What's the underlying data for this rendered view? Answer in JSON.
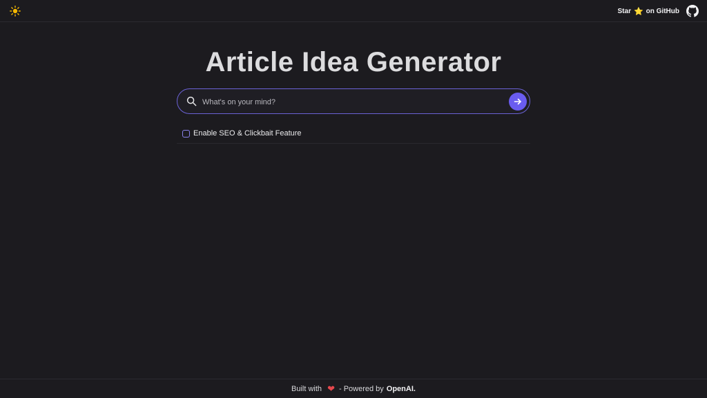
{
  "header": {
    "theme_icon": "sun-icon",
    "github_star_prefix": "Star",
    "github_star_icon": "⭐",
    "github_star_suffix": "on GitHub",
    "github_icon": "github-icon"
  },
  "main": {
    "title": "Article Idea Generator",
    "search": {
      "placeholder": "What's on your mind?",
      "value": "",
      "search_icon": "search-icon",
      "submit_icon": "arrow-right-icon"
    },
    "seo_option": {
      "label": "Enable SEO & Clickbait Feature",
      "checked": false
    }
  },
  "footer": {
    "built_with": "Built with",
    "heart": "❤",
    "powered_by": "- Powered by",
    "brand": "OpenAI."
  },
  "colors": {
    "background": "#1c1b1f",
    "accent": "#6a5cf0",
    "border_accent": "#6b62d6",
    "heart": "#e5484d",
    "star": "#f5c518"
  }
}
